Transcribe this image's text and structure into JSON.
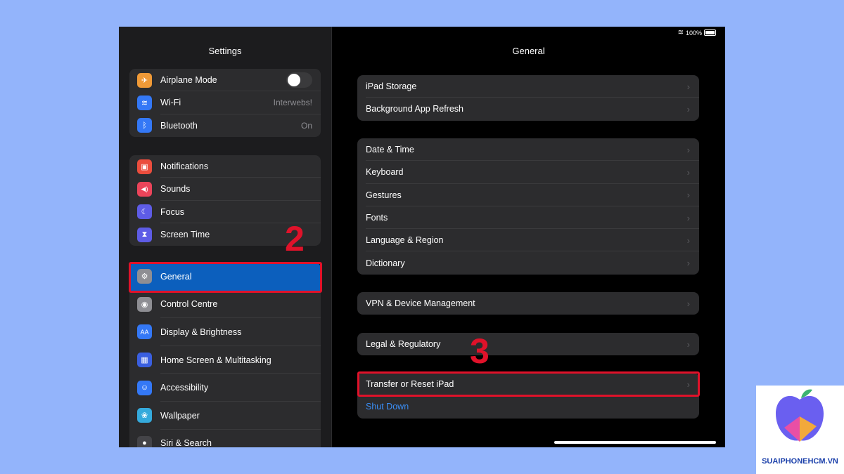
{
  "status": {
    "battery": "100%"
  },
  "sidebar": {
    "title": "Settings",
    "group1": [
      {
        "label": "Airplane Mode",
        "icon": "airplane-icon",
        "color": "#f09a37",
        "glyph": "✈",
        "toggle": "off"
      },
      {
        "label": "Wi-Fi",
        "icon": "wifi-icon",
        "color": "#3478f6",
        "glyph": "≋",
        "value": "Interwebs!"
      },
      {
        "label": "Bluetooth",
        "icon": "bluetooth-icon",
        "color": "#3478f6",
        "glyph": "ᛒ",
        "value": "On"
      }
    ],
    "group2": [
      {
        "label": "Notifications",
        "icon": "notifications-icon",
        "color": "#eb4d3d",
        "glyph": "▣"
      },
      {
        "label": "Sounds",
        "icon": "sounds-icon",
        "color": "#eb445a",
        "glyph": "◀)"
      },
      {
        "label": "Focus",
        "icon": "focus-icon",
        "color": "#5e5ce6",
        "glyph": "☾"
      },
      {
        "label": "Screen Time",
        "icon": "hourglass-icon",
        "color": "#5e5ce6",
        "glyph": "⧗"
      }
    ],
    "group3": [
      {
        "label": "General",
        "icon": "gear-icon",
        "color": "#8e8e93",
        "glyph": "⚙",
        "selected": true
      },
      {
        "label": "Control Centre",
        "icon": "control-centre-icon",
        "color": "#8e8e93",
        "glyph": "◉"
      },
      {
        "label": "Display & Brightness",
        "icon": "display-icon",
        "color": "#3478f6",
        "glyph": "AA"
      },
      {
        "label": "Home Screen & Multitasking",
        "icon": "home-screen-icon",
        "color": "#3a5fe0",
        "glyph": "▦"
      },
      {
        "label": "Accessibility",
        "icon": "accessibility-icon",
        "color": "#3478f6",
        "glyph": "☺"
      },
      {
        "label": "Wallpaper",
        "icon": "wallpaper-icon",
        "color": "#35aadc",
        "glyph": "❀"
      },
      {
        "label": "Siri & Search",
        "icon": "siri-icon",
        "color": "#444448",
        "glyph": "●"
      }
    ]
  },
  "main": {
    "title": "General",
    "groups": [
      [
        "iPad Storage",
        "Background App Refresh"
      ],
      [
        "Date & Time",
        "Keyboard",
        "Gestures",
        "Fonts",
        "Language & Region",
        "Dictionary"
      ],
      [
        "VPN & Device Management"
      ],
      [
        "Legal & Regulatory"
      ]
    ],
    "transfer": "Transfer or Reset iPad",
    "shutdown": "Shut Down"
  },
  "annotations": {
    "step2": "2",
    "step3": "3"
  },
  "watermark": {
    "text": "SUAIPHONEHCM.VN"
  },
  "colors": {
    "highlight": "#e0122a",
    "selected": "#0c5fbd",
    "link": "#3a8ef6"
  }
}
